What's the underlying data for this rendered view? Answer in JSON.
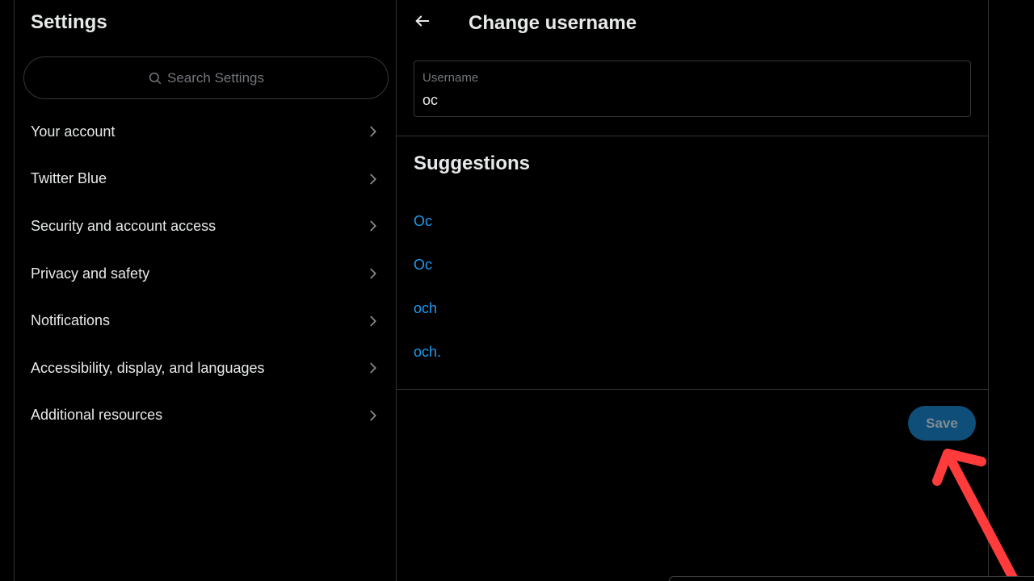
{
  "settings": {
    "title": "Settings",
    "search_placeholder": "Search Settings",
    "items": [
      {
        "label": "Your account"
      },
      {
        "label": "Twitter Blue"
      },
      {
        "label": "Security and account access"
      },
      {
        "label": "Privacy and safety"
      },
      {
        "label": "Notifications"
      },
      {
        "label": "Accessibility, display, and languages"
      },
      {
        "label": "Additional resources"
      }
    ]
  },
  "detail": {
    "title": "Change username",
    "username_field": {
      "label": "Username",
      "value": "oc"
    },
    "suggestions_title": "Suggestions",
    "suggestions": [
      "Oc",
      "Oc",
      "och",
      "och."
    ],
    "save_label": "Save"
  },
  "colors": {
    "background": "#000000",
    "text": "#e7e9ea",
    "muted": "#71767b",
    "link": "#1d9bf0",
    "save_bg": "#0f4e78",
    "annotation": "#ff3b3b"
  },
  "icons": {
    "search": "search-icon",
    "chevron": "chevron-right-icon",
    "back": "arrow-left-icon"
  }
}
